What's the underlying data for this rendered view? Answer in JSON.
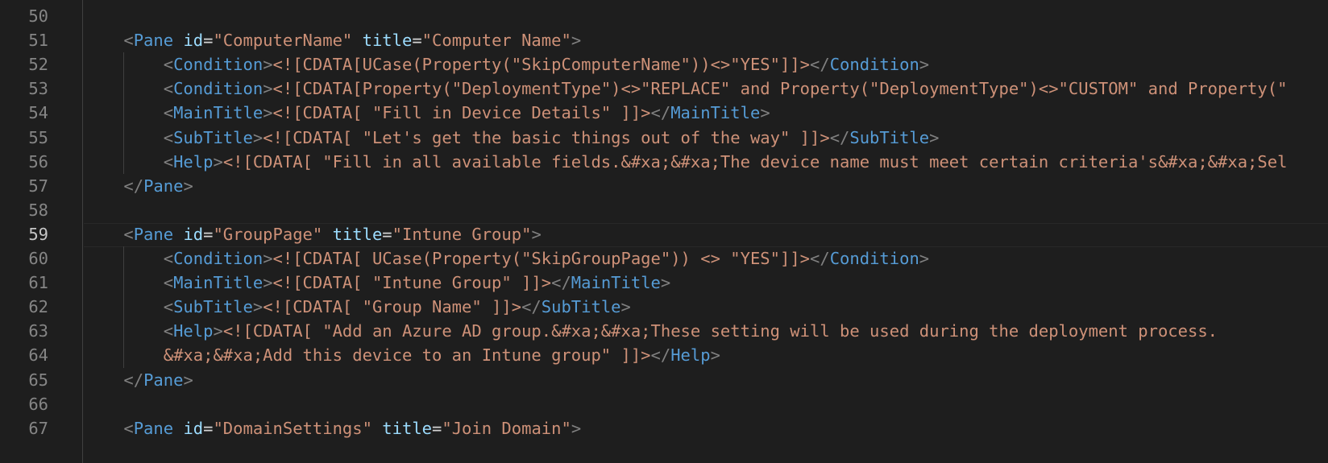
{
  "editor": {
    "line_numbers": [
      "50",
      "51",
      "52",
      "53",
      "54",
      "55",
      "56",
      "57",
      "58",
      "59",
      "60",
      "61",
      "62",
      "63",
      "64",
      "65",
      "66",
      "67"
    ],
    "active_line": "59",
    "lines": [
      {
        "num": "50",
        "indent": "",
        "tokens": []
      },
      {
        "num": "51",
        "indent": "    ",
        "tokens": [
          {
            "t": "bracket",
            "v": "<"
          },
          {
            "t": "tag",
            "v": "Pane"
          },
          {
            "t": "text_ws",
            "v": " "
          },
          {
            "t": "attr",
            "v": "id"
          },
          {
            "t": "eq",
            "v": "="
          },
          {
            "t": "str",
            "v": "\"ComputerName\""
          },
          {
            "t": "text_ws",
            "v": " "
          },
          {
            "t": "attr",
            "v": "title"
          },
          {
            "t": "eq",
            "v": "="
          },
          {
            "t": "str",
            "v": "\"Computer Name\""
          },
          {
            "t": "bracket",
            "v": ">"
          }
        ]
      },
      {
        "num": "52",
        "indent": "        ",
        "tokens": [
          {
            "t": "bracket",
            "v": "<"
          },
          {
            "t": "tag",
            "v": "Condition"
          },
          {
            "t": "bracket",
            "v": ">"
          },
          {
            "t": "text",
            "v": "<![CDATA[UCase(Property(\"SkipComputerName\"))<>\"YES\"]]>"
          },
          {
            "t": "bracket",
            "v": "</"
          },
          {
            "t": "tag",
            "v": "Condition"
          },
          {
            "t": "bracket",
            "v": ">"
          }
        ]
      },
      {
        "num": "53",
        "indent": "        ",
        "tokens": [
          {
            "t": "bracket",
            "v": "<"
          },
          {
            "t": "tag",
            "v": "Condition"
          },
          {
            "t": "bracket",
            "v": ">"
          },
          {
            "t": "text",
            "v": "<![CDATA[Property(\"DeploymentType\")<>\"REPLACE\" and Property(\"DeploymentType\")<>\"CUSTOM\" and Property(\""
          }
        ]
      },
      {
        "num": "54",
        "indent": "        ",
        "tokens": [
          {
            "t": "bracket",
            "v": "<"
          },
          {
            "t": "tag",
            "v": "MainTitle"
          },
          {
            "t": "bracket",
            "v": ">"
          },
          {
            "t": "text",
            "v": "<![CDATA[ \"Fill in Device Details\" ]]>"
          },
          {
            "t": "bracket",
            "v": "</"
          },
          {
            "t": "tag",
            "v": "MainTitle"
          },
          {
            "t": "bracket",
            "v": ">"
          }
        ]
      },
      {
        "num": "55",
        "indent": "        ",
        "tokens": [
          {
            "t": "bracket",
            "v": "<"
          },
          {
            "t": "tag",
            "v": "SubTitle"
          },
          {
            "t": "bracket",
            "v": ">"
          },
          {
            "t": "text",
            "v": "<![CDATA[ \"Let's get the basic things out of the way\" ]]>"
          },
          {
            "t": "bracket",
            "v": "</"
          },
          {
            "t": "tag",
            "v": "SubTitle"
          },
          {
            "t": "bracket",
            "v": ">"
          }
        ]
      },
      {
        "num": "56",
        "indent": "        ",
        "tokens": [
          {
            "t": "bracket",
            "v": "<"
          },
          {
            "t": "tag",
            "v": "Help"
          },
          {
            "t": "bracket",
            "v": ">"
          },
          {
            "t": "text",
            "v": "<![CDATA[ \"Fill in all available fields.&#xa;&#xa;The device name must meet certain criteria's&#xa;&#xa;Sel"
          }
        ]
      },
      {
        "num": "57",
        "indent": "    ",
        "tokens": [
          {
            "t": "bracket",
            "v": "</"
          },
          {
            "t": "tag",
            "v": "Pane"
          },
          {
            "t": "bracket",
            "v": ">"
          }
        ]
      },
      {
        "num": "58",
        "indent": "",
        "tokens": []
      },
      {
        "num": "59",
        "indent": "    ",
        "tokens": [
          {
            "t": "bracket",
            "v": "<"
          },
          {
            "t": "tag",
            "v": "Pane"
          },
          {
            "t": "text_ws",
            "v": " "
          },
          {
            "t": "attr",
            "v": "id"
          },
          {
            "t": "eq",
            "v": "="
          },
          {
            "t": "str",
            "v": "\"GroupPage\""
          },
          {
            "t": "text_ws",
            "v": " "
          },
          {
            "t": "attr",
            "v": "title"
          },
          {
            "t": "eq",
            "v": "="
          },
          {
            "t": "str",
            "v": "\"Intune Group\""
          },
          {
            "t": "bracket",
            "v": ">"
          }
        ]
      },
      {
        "num": "60",
        "indent": "        ",
        "tokens": [
          {
            "t": "bracket",
            "v": "<"
          },
          {
            "t": "tag",
            "v": "Condition"
          },
          {
            "t": "bracket",
            "v": ">"
          },
          {
            "t": "text",
            "v": "<![CDATA[ UCase(Property(\"SkipGroupPage\")) <> \"YES\"]]>"
          },
          {
            "t": "bracket",
            "v": "</"
          },
          {
            "t": "tag",
            "v": "Condition"
          },
          {
            "t": "bracket",
            "v": ">"
          }
        ]
      },
      {
        "num": "61",
        "indent": "        ",
        "tokens": [
          {
            "t": "bracket",
            "v": "<"
          },
          {
            "t": "tag",
            "v": "MainTitle"
          },
          {
            "t": "bracket",
            "v": ">"
          },
          {
            "t": "text",
            "v": "<![CDATA[ \"Intune Group\" ]]>"
          },
          {
            "t": "bracket",
            "v": "</"
          },
          {
            "t": "tag",
            "v": "MainTitle"
          },
          {
            "t": "bracket",
            "v": ">"
          }
        ]
      },
      {
        "num": "62",
        "indent": "        ",
        "tokens": [
          {
            "t": "bracket",
            "v": "<"
          },
          {
            "t": "tag",
            "v": "SubTitle"
          },
          {
            "t": "bracket",
            "v": ">"
          },
          {
            "t": "text",
            "v": "<![CDATA[ \"Group Name\" ]]>"
          },
          {
            "t": "bracket",
            "v": "</"
          },
          {
            "t": "tag",
            "v": "SubTitle"
          },
          {
            "t": "bracket",
            "v": ">"
          }
        ]
      },
      {
        "num": "63",
        "indent": "        ",
        "tokens": [
          {
            "t": "bracket",
            "v": "<"
          },
          {
            "t": "tag",
            "v": "Help"
          },
          {
            "t": "bracket",
            "v": ">"
          },
          {
            "t": "text",
            "v": "<![CDATA[ \"Add an Azure AD group.&#xa;&#xa;These setting will be used during the deployment process."
          }
        ]
      },
      {
        "num": "64",
        "indent": "        ",
        "tokens": [
          {
            "t": "text",
            "v": "&#xa;&#xa;Add this device to an Intune group\" ]]>"
          },
          {
            "t": "bracket",
            "v": "</"
          },
          {
            "t": "tag",
            "v": "Help"
          },
          {
            "t": "bracket",
            "v": ">"
          }
        ]
      },
      {
        "num": "65",
        "indent": "    ",
        "tokens": [
          {
            "t": "bracket",
            "v": "</"
          },
          {
            "t": "tag",
            "v": "Pane"
          },
          {
            "t": "bracket",
            "v": ">"
          }
        ]
      },
      {
        "num": "66",
        "indent": "",
        "tokens": []
      },
      {
        "num": "67",
        "indent": "    ",
        "tokens": [
          {
            "t": "bracket",
            "v": "<"
          },
          {
            "t": "tag",
            "v": "Pane"
          },
          {
            "t": "text_ws",
            "v": " "
          },
          {
            "t": "attr",
            "v": "id"
          },
          {
            "t": "eq",
            "v": "="
          },
          {
            "t": "str",
            "v": "\"DomainSettings\""
          },
          {
            "t": "text_ws",
            "v": " "
          },
          {
            "t": "attr",
            "v": "title"
          },
          {
            "t": "eq",
            "v": "="
          },
          {
            "t": "str",
            "v": "\"Join Domain\""
          },
          {
            "t": "bracket",
            "v": ">"
          }
        ]
      }
    ]
  },
  "colors": {
    "background": "#1e1e1e",
    "line_number": "#858585",
    "line_number_active": "#c6c6c6",
    "tag_bracket": "#808080",
    "tag_name": "#569cd6",
    "attribute_name": "#9cdcfe",
    "string": "#ce9178",
    "text": "#ce9178"
  }
}
